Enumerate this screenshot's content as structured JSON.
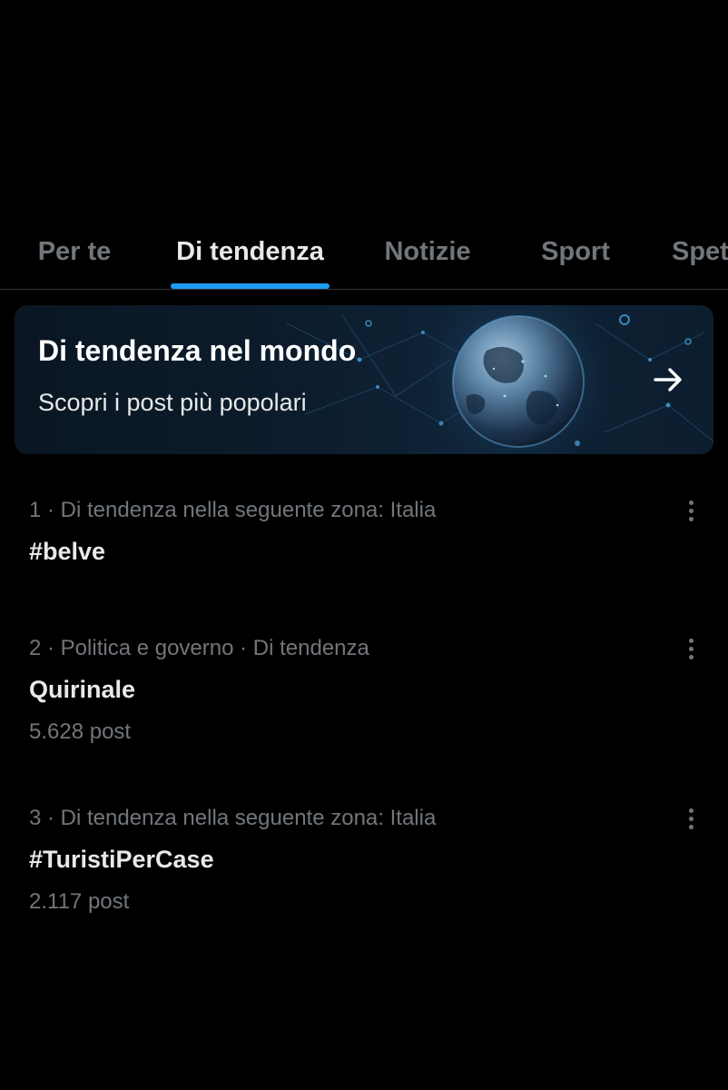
{
  "tabs": [
    {
      "label": "Per te",
      "active": false
    },
    {
      "label": "Di tendenza",
      "active": true
    },
    {
      "label": "Notizie",
      "active": false
    },
    {
      "label": "Sport",
      "active": false
    },
    {
      "label": "Spet",
      "active": false
    }
  ],
  "banner": {
    "title": "Di tendenza nel mondo",
    "subtitle": "Scopri i post più popolari",
    "arrow_icon": "arrow-right-icon"
  },
  "trends": [
    {
      "meta": "1 · Di tendenza nella seguente zona: Italia",
      "name": "#belve",
      "count": ""
    },
    {
      "meta": "2 · Politica e governo · Di tendenza",
      "name": "Quirinale",
      "count": "5.628 post"
    },
    {
      "meta": "3 · Di tendenza nella seguente zona: Italia",
      "name": "#TuristiPerCase",
      "count": "2.117 post"
    }
  ],
  "colors": {
    "background": "#000000",
    "accent": "#1d9bf0",
    "text_primary": "#e7e9ea",
    "text_secondary": "#71767b",
    "divider": "#2f3336"
  }
}
